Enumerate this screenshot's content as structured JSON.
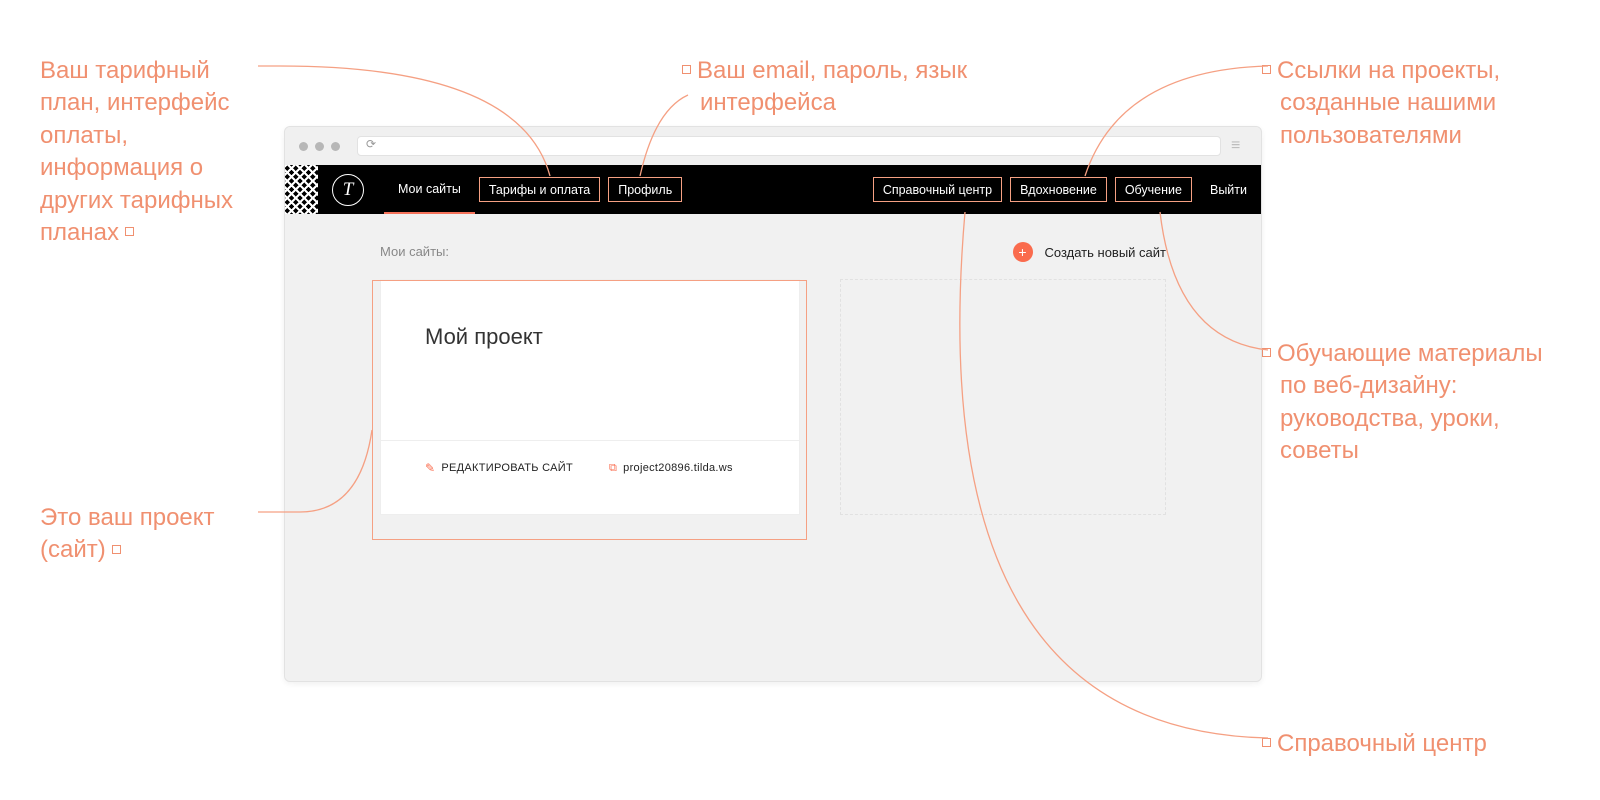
{
  "annotations": {
    "tariffs": "Ваш тарифный план, интерфейс оплаты, информация о других тарифных планах",
    "profile": "Ваш email, пароль, язык интерфейса",
    "inspiration": "Ссылки на проекты, созданные нашими пользователями",
    "learning": "Обучающие материалы по веб-дизайну: руководства, уроки, советы",
    "project": "Это ваш проект (сайт)",
    "help": "Справочный центр"
  },
  "nav": {
    "my_sites": "Мои сайты",
    "tariffs": "Тарифы и оплата",
    "profile": "Профиль",
    "help": "Справочный центр",
    "inspiration": "Вдохновение",
    "learning": "Обучение",
    "logout": "Выйти"
  },
  "content": {
    "section_title": "Мои сайты:",
    "create_label": "Создать новый сайт",
    "project_title": "Мой проект",
    "edit_label": "РЕДАКТИРОВАТЬ САЙТ",
    "project_url": "project20896.tilda.ws"
  },
  "logo_letter": "T"
}
